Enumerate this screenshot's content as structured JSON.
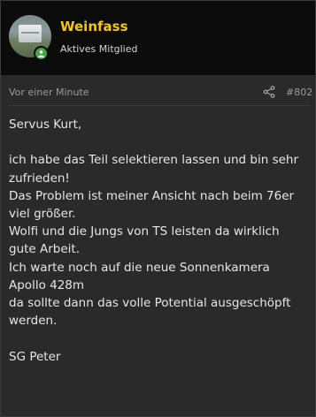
{
  "post": {
    "author": {
      "username": "Weinfass",
      "title": "Aktives Mitglied",
      "online": true
    },
    "time": "Vor einer Minute",
    "post_number": "#802",
    "body_lines": [
      "Servus Kurt,",
      "",
      "ich habe das Teil selektieren lassen und bin sehr",
      "zufrieden!",
      "Das Problem ist meiner Ansicht nach beim 76er",
      "viel größer.",
      "Wolfi und die Jungs von TS leisten da wirklich",
      "gute Arbeit.",
      "Ich warte noch auf die neue Sonnenkamera",
      "Apollo 428m",
      "da sollte dann das volle Potential ausgeschöpft",
      "werden.",
      "",
      "SG Peter"
    ]
  },
  "icons": {
    "share": "share-icon",
    "online": "online-status-icon"
  },
  "colors": {
    "username": "#f5c518",
    "online": "#4aa34a",
    "background": "#2a2a2a",
    "header": "#0b0b0b"
  }
}
